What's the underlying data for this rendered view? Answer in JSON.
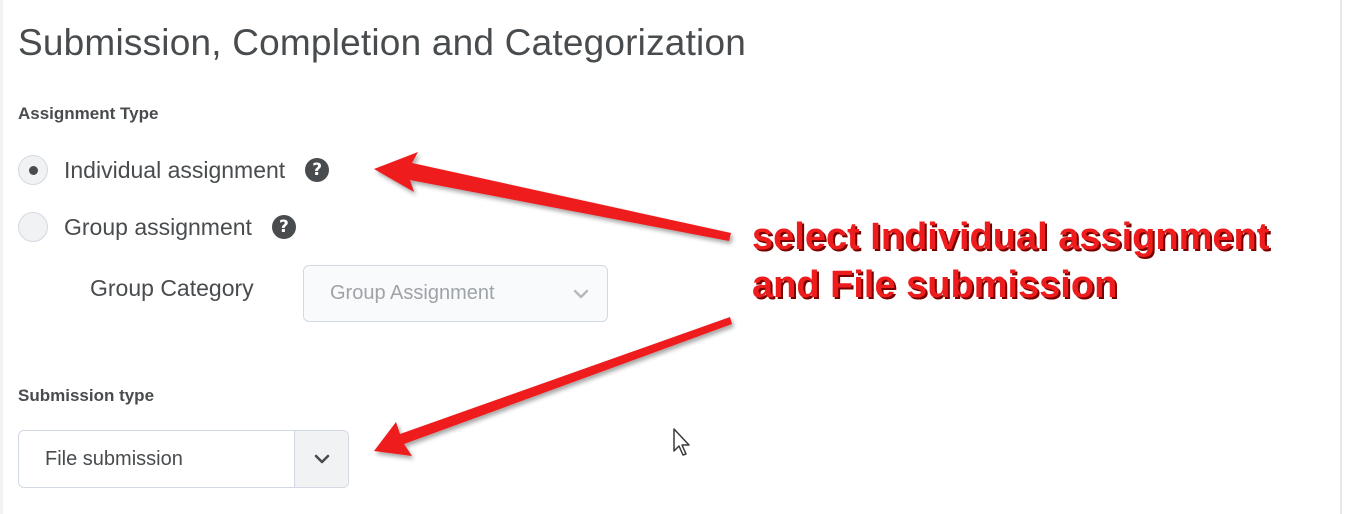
{
  "page": {
    "title": "Submission, Completion and Categorization"
  },
  "assignment_type": {
    "label": "Assignment Type",
    "options": [
      {
        "label": "Individual assignment",
        "selected": true,
        "help_icon": "question-circle-icon"
      },
      {
        "label": "Group assignment",
        "selected": false,
        "help_icon": "question-circle-icon"
      }
    ],
    "group_category": {
      "label": "Group Category",
      "value": "Group Assignment",
      "disabled": true
    }
  },
  "submission_type": {
    "label": "Submission type",
    "value": "File submission"
  },
  "annotation": {
    "line1": "select Individual assignment",
    "line2": "and File submission",
    "color": "#ee1c1c"
  },
  "icons": {
    "help": "?",
    "dropdown": "chevron-down-icon",
    "pointer": "mouse-cursor-icon"
  },
  "theme": {
    "text": "#494c4e",
    "border": "#d3d9e3",
    "arrow": "#ee1c1c"
  }
}
